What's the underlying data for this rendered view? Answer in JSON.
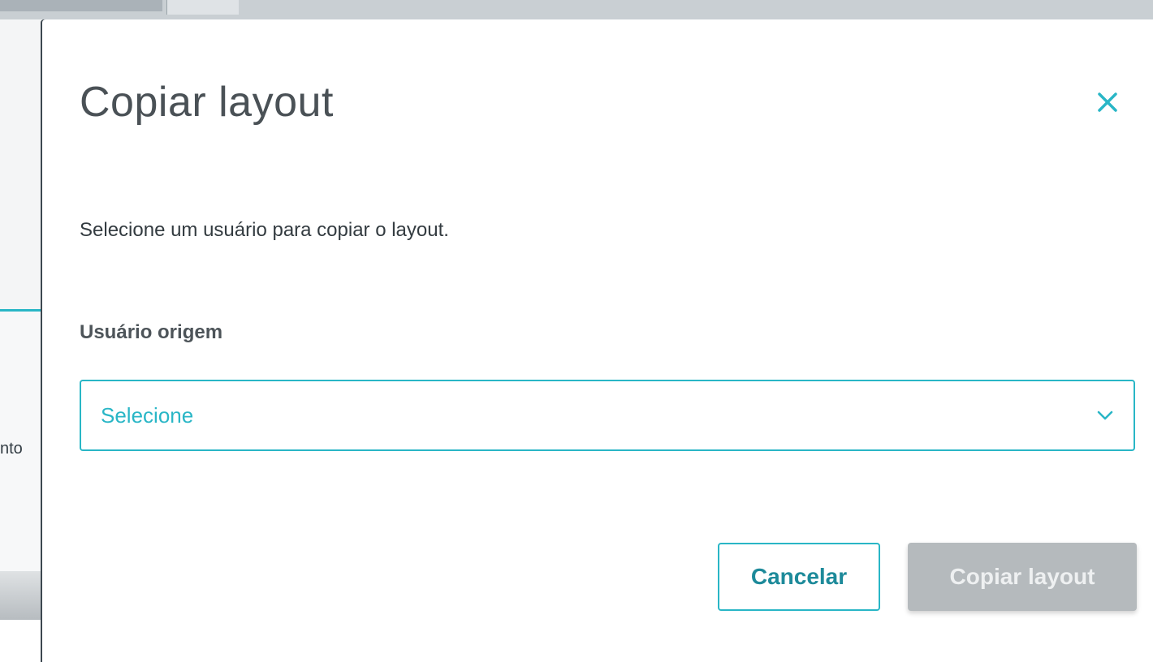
{
  "background": {
    "left_partial_text": "nto"
  },
  "dialog": {
    "title": "Copiar layout",
    "description": "Selecione um usuário para copiar o layout.",
    "field_label": "Usuário origem",
    "select": {
      "value": "Selecione"
    },
    "cancel_label": "Cancelar",
    "confirm_label": "Copiar layout"
  },
  "colors": {
    "accent": "#29b6c6",
    "disabled_button": "#b5babd"
  },
  "icons": {
    "close": "close-icon",
    "dropdown": "chevron-down-icon"
  }
}
